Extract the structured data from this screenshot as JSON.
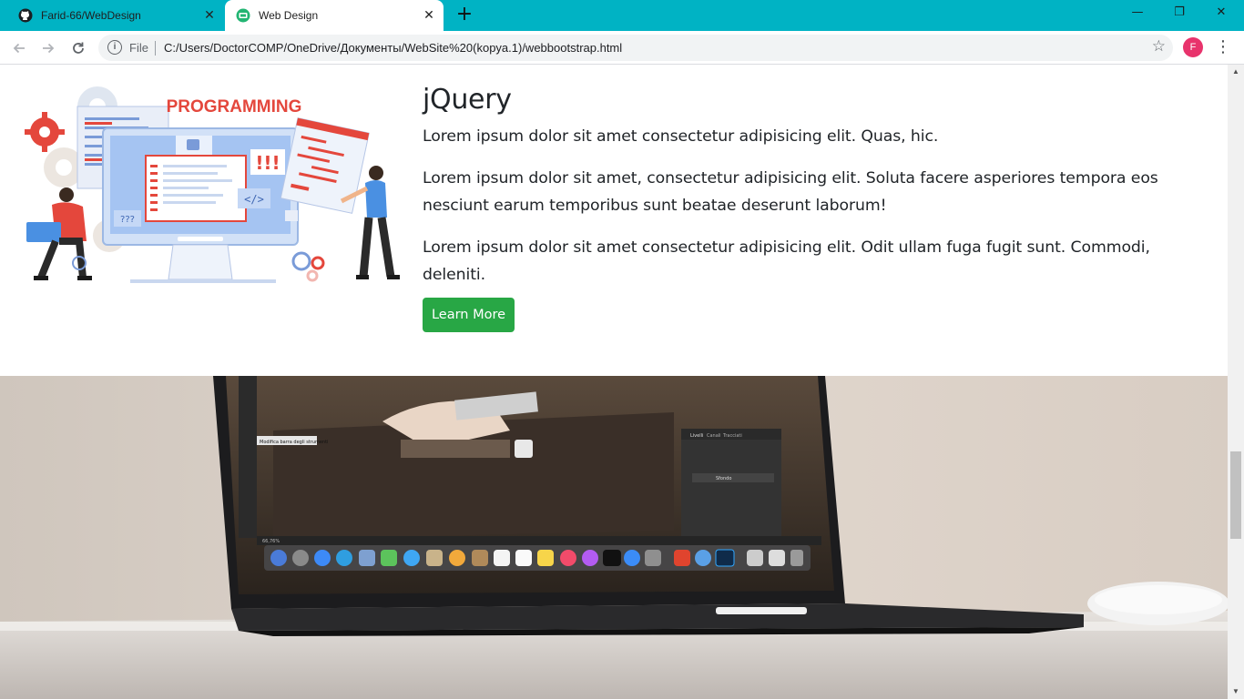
{
  "browser": {
    "tabs": [
      {
        "title": "Farid-66/WebDesign",
        "icon": "github-icon",
        "active": false
      },
      {
        "title": "Web Design",
        "icon": "site-favicon-icon",
        "active": true
      }
    ],
    "new_tab_symbol": "+",
    "window_controls": {
      "minimize": "—",
      "maximize": "❐",
      "close": "✕"
    },
    "address_bar": {
      "scheme_label": "File",
      "url": "C:/Users/DoctorCOMP/OneDrive/Документы/WebSite%20(kopya.1)/webbootstrap.html"
    },
    "profile_initial": "F",
    "accent_color": "#00b3c4"
  },
  "page": {
    "feature": {
      "image_caption": "PROGRAMMING",
      "image_badge": "!!!",
      "image_code_glyph": "</>",
      "image_question_badge": "???",
      "title": "jQuery",
      "paragraphs": [
        "Lorem ipsum dolor sit amet consectetur adipisicing elit. Quas, hic.",
        "Lorem ipsum dolor sit amet, consectetur adipisicing elit. Soluta facere asperiores tempora eos nesciunt earum temporibus sunt beatae deserunt laborum!",
        "Lorem ipsum dolor sit amet consectetur adipisicing elit. Odit ullam fuga fugit sunt. Commodi, deleniti."
      ],
      "button_label": "Learn More",
      "button_color": "#28a745"
    },
    "laptop_screen": {
      "tooltip_text": "Modifica barra degli strumenti",
      "panel_tabs": [
        "Livelli",
        "Canali",
        "Tracciati"
      ],
      "layer_name": "Sfondo",
      "status_text": "66,76%"
    }
  }
}
